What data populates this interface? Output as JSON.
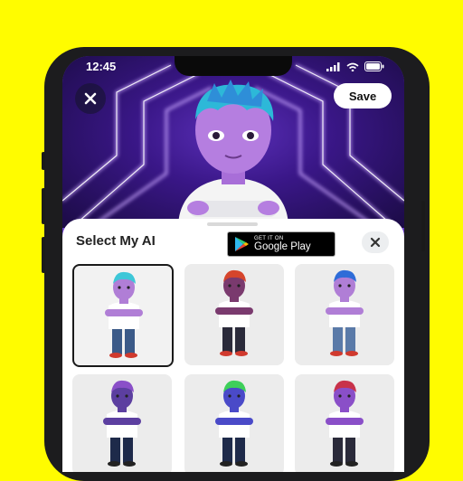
{
  "status_bar": {
    "time": "12:45"
  },
  "header": {
    "save_label": "Save"
  },
  "sheet": {
    "title": "Select My AI",
    "store_badge": {
      "line1": "GET IT ON",
      "line2": "Google Play"
    }
  },
  "avatars": [
    {
      "hair": "#3ec7d8",
      "skin": "#b07ed6",
      "shirt": "#ffffff",
      "pants": "#3b5a88",
      "shoes": "#d03a2e",
      "selected": true
    },
    {
      "hair": "#d6452c",
      "skin": "#7a3a6e",
      "shirt": "#ffffff",
      "pants": "#2a2a3a",
      "shoes": "#d03a2e",
      "selected": false
    },
    {
      "hair": "#2e6cd8",
      "skin": "#b07ed6",
      "shirt": "#ffffff",
      "pants": "#5a7aa8",
      "shoes": "#d03a2e",
      "selected": false
    },
    {
      "hair": "#8a4fc8",
      "skin": "#5c3fa0",
      "shirt": "#ffffff",
      "pants": "#1e2a4a",
      "shoes": "#222222",
      "selected": false
    },
    {
      "hair": "#3ecf5a",
      "skin": "#4a4ac8",
      "shirt": "#ffffff",
      "pants": "#1e2a4a",
      "shoes": "#222222",
      "selected": false
    },
    {
      "hair": "#c8324a",
      "skin": "#8a4fc8",
      "shirt": "#ffffff",
      "pants": "#2a2a3a",
      "shoes": "#222222",
      "selected": false
    }
  ],
  "colors": {
    "background": "#FFFC00",
    "accent": "#6a3dc6"
  }
}
